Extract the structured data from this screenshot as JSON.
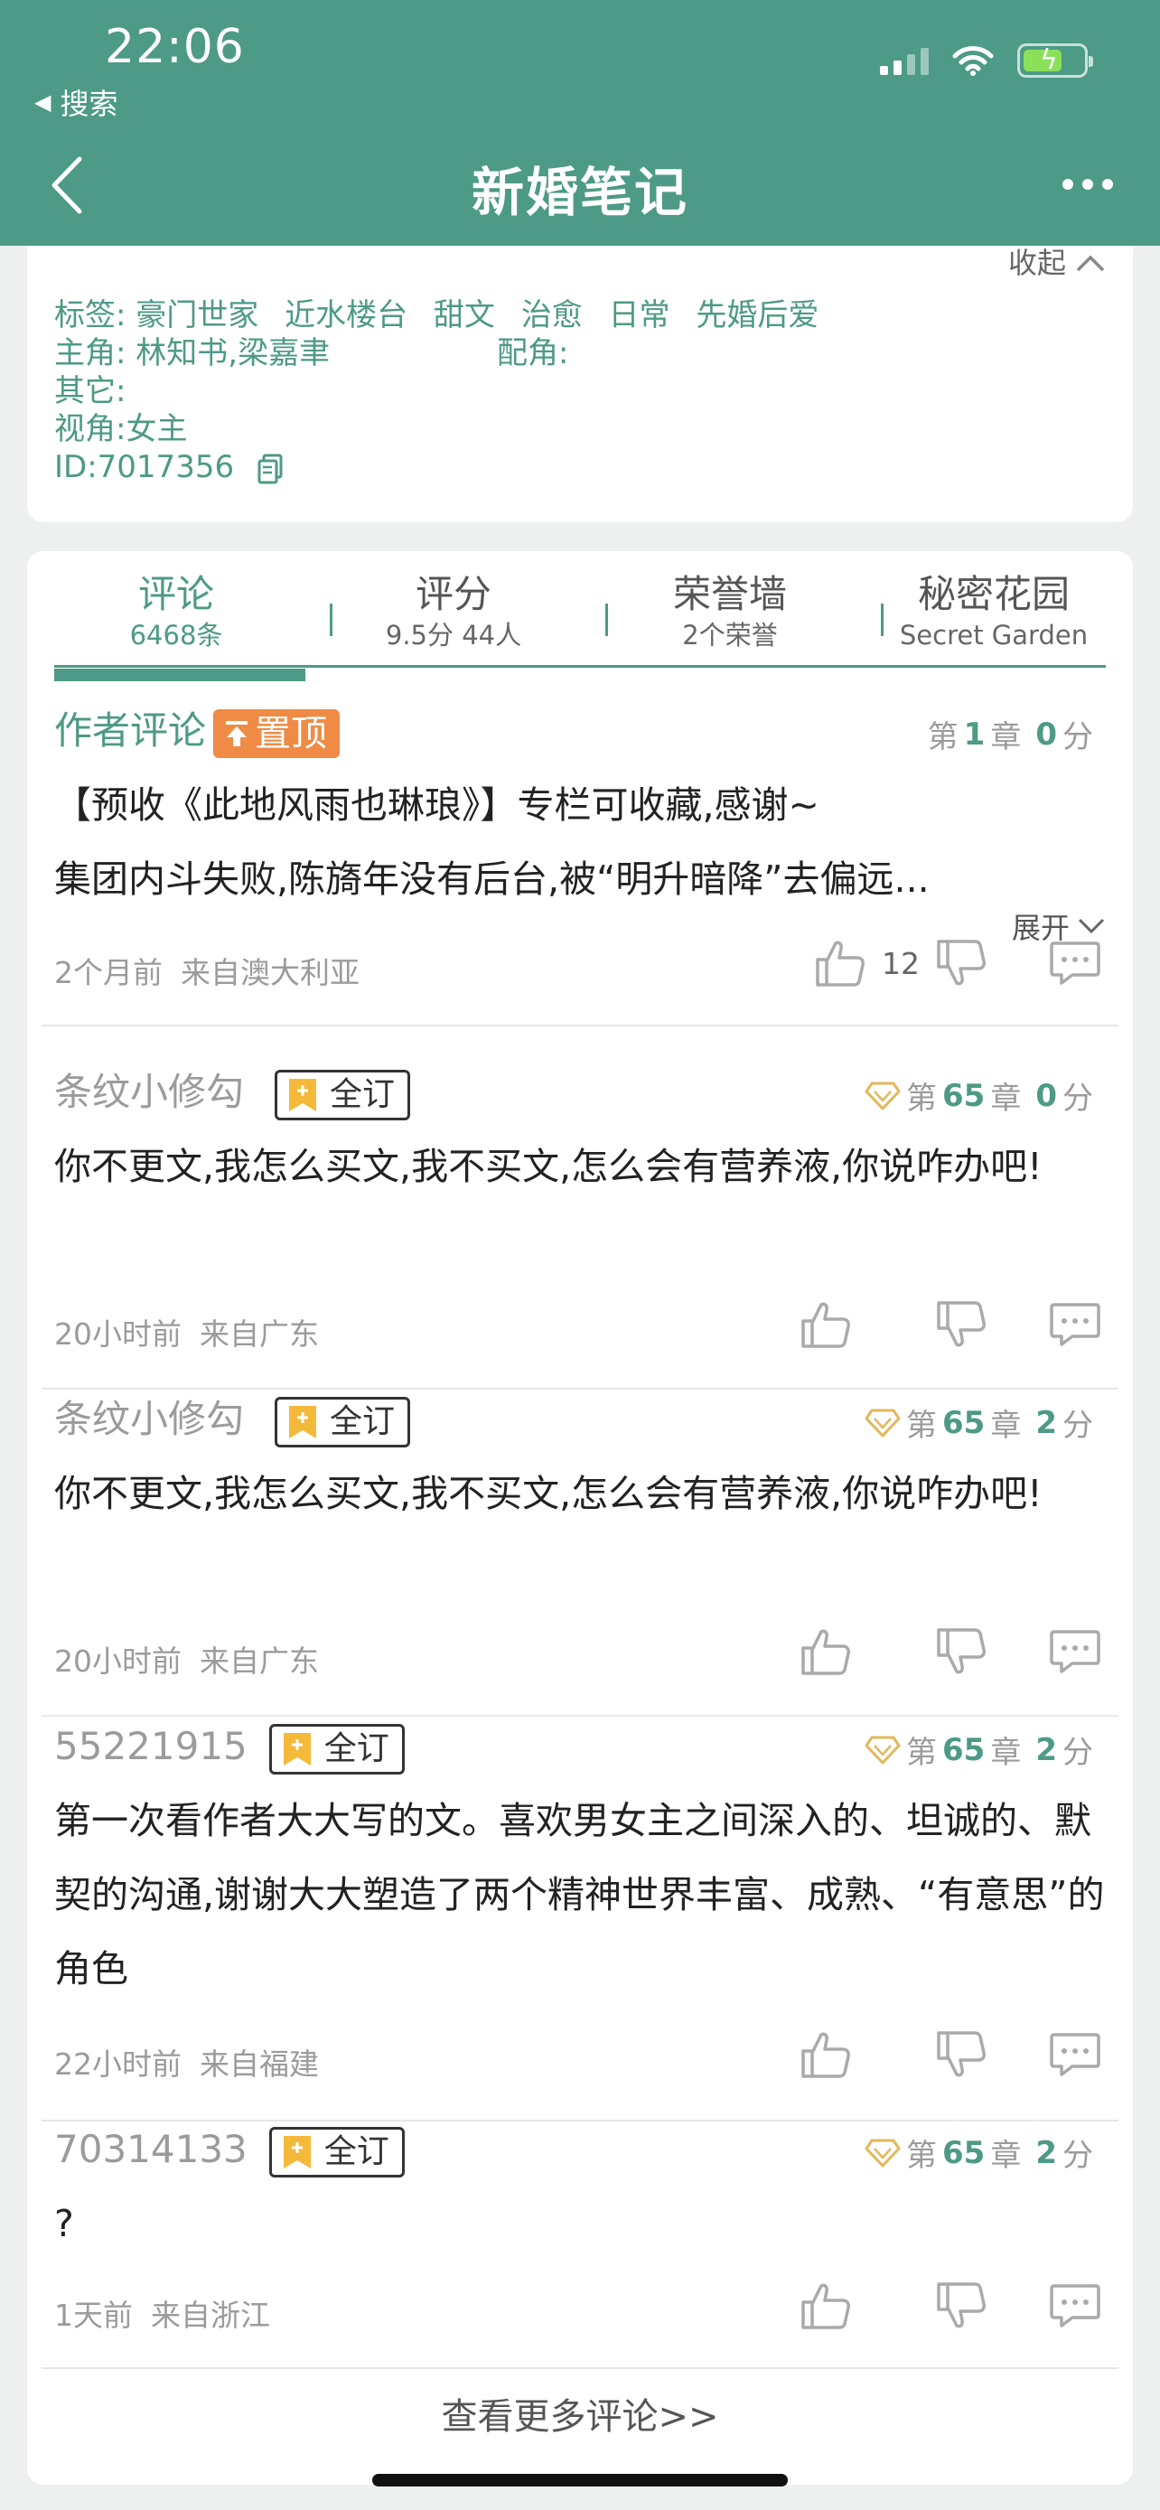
{
  "status": {
    "time": "22:06",
    "back_label": "搜索"
  },
  "nav": {
    "title": "新婚笔记"
  },
  "info": {
    "collapse_label": "收起",
    "tags_label": "标签:",
    "tags": [
      "豪门世家",
      "近水楼台",
      "甜文",
      "治愈",
      "日常",
      "先婚后爱"
    ],
    "lead_label": "主角:",
    "lead": "林知书,梁嘉聿",
    "support_label": "配角:",
    "other_label": "其它:",
    "pov": "视角:女主",
    "id": "ID:7017356"
  },
  "tabs": [
    {
      "label": "评论",
      "sub": "6468条"
    },
    {
      "label": "评分",
      "sub": "9.5分 44人"
    },
    {
      "label": "荣誉墙",
      "sub": "2个荣誉"
    },
    {
      "label": "秘密花园",
      "sub": "Secret Garden"
    }
  ],
  "comments": [
    {
      "user": "作者评论",
      "pin": "置顶",
      "chapter_pre": "第",
      "chapter": "1",
      "chapter_post": "章",
      "score": "0",
      "score_unit": "分",
      "line1": "【预收《此地风雨也琳琅》】专栏可收藏,感谢~",
      "line2": "集团内斗失败,陈旖年没有后台,被“明升暗降”去偏远...",
      "expand": "展开",
      "time": "2个月前",
      "location": "来自澳大利亚",
      "likes": "12"
    },
    {
      "user": "条纹小修勾",
      "badge": "全订",
      "chapter_pre": "第",
      "chapter": "65",
      "chapter_post": "章",
      "score": "0",
      "score_unit": "分",
      "text": "你不更文,我怎么买文,我不买文,怎么会有营养液,你说咋办吧!",
      "time": "20小时前",
      "location": "来自广东"
    },
    {
      "user": "条纹小修勾",
      "badge": "全订",
      "chapter_pre": "第",
      "chapter": "65",
      "chapter_post": "章",
      "score": "2",
      "score_unit": "分",
      "text": "你不更文,我怎么买文,我不买文,怎么会有营养液,你说咋办吧!",
      "time": "20小时前",
      "location": "来自广东"
    },
    {
      "user": "55221915",
      "badge": "全订",
      "chapter_pre": "第",
      "chapter": "65",
      "chapter_post": "章",
      "score": "2",
      "score_unit": "分",
      "text": "第一次看作者大大写的文。喜欢男女主之间深入的、坦诚的、默契的沟通,谢谢大大塑造了两个精神世界丰富、成熟、“有意思”的角色",
      "time": "22小时前",
      "location": "来自福建"
    },
    {
      "user": "70314133",
      "badge": "全订",
      "chapter_pre": "第",
      "chapter": "65",
      "chapter_post": "章",
      "score": "2",
      "score_unit": "分",
      "text": "?",
      "time": "1天前",
      "location": "来自浙江"
    }
  ],
  "more_label": "查看更多评论>>",
  "colors": {
    "header": "#4d9a86",
    "accent": "#4d9a86",
    "pin": "#ef8b45",
    "badge_icon": "#f5b93a"
  }
}
